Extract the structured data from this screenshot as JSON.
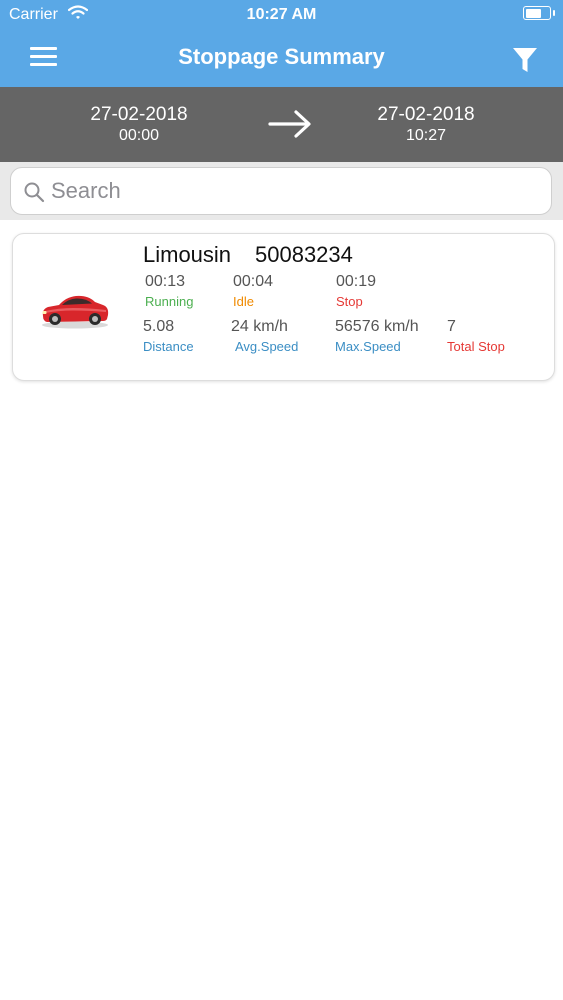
{
  "status_bar": {
    "carrier": "Carrier",
    "time": "10:27 AM"
  },
  "header": {
    "title": "Stoppage Summary",
    "menu_icon": "hamburger-menu-icon",
    "filter_icon": "filter-funnel-icon",
    "background_color": "#5aa8e6"
  },
  "date_range": {
    "from_date": "27-02-2018",
    "from_time": "00:00",
    "to_date": "27-02-2018",
    "to_time": "10:27",
    "arrow_icon": "arrow-right-icon"
  },
  "search": {
    "placeholder": "Search",
    "value": ""
  },
  "vehicles": [
    {
      "name": "Limousin",
      "number": "50083234",
      "icon": "red-car-icon",
      "running_time": "00:13",
      "running_label": "Running",
      "idle_time": "00:04",
      "idle_label": "Idle",
      "stop_time": "00:19",
      "stop_label": "Stop",
      "distance": "5.08",
      "distance_label": "Distance",
      "avg_speed": "24 km/h",
      "avg_speed_label": "Avg.Speed",
      "max_speed": "56576 km/h",
      "max_speed_label": "Max.Speed",
      "total_stop": "7",
      "total_stop_label": "Total Stop"
    }
  ]
}
